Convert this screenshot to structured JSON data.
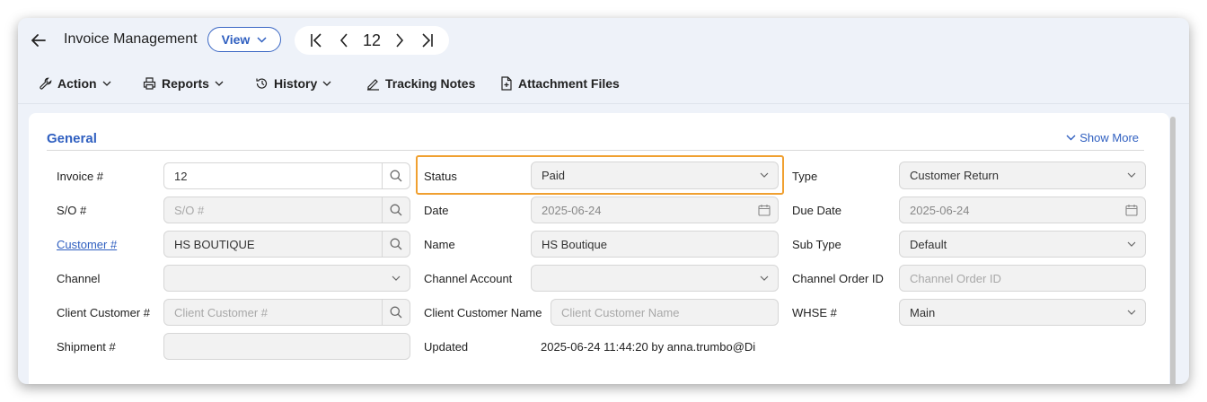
{
  "header": {
    "title": "Invoice Management",
    "view_label": "View",
    "record_number": "12"
  },
  "toolbar": {
    "action": "Action",
    "reports": "Reports",
    "history": "History",
    "tracking_notes": "Tracking Notes",
    "attachment_files": "Attachment Files"
  },
  "general": {
    "title": "General",
    "show_more": "Show More"
  },
  "fields": {
    "invoice": {
      "label": "Invoice #",
      "value": "12"
    },
    "so": {
      "label": "S/O #",
      "placeholder": "S/O #"
    },
    "customer": {
      "label": "Customer #",
      "value": "HS BOUTIQUE"
    },
    "channel": {
      "label": "Channel",
      "value": ""
    },
    "client_customer": {
      "label": "Client Customer #",
      "placeholder": "Client Customer #"
    },
    "shipment": {
      "label": "Shipment #",
      "value": ""
    },
    "status": {
      "label": "Status",
      "value": "Paid"
    },
    "date": {
      "label": "Date",
      "value": "2025-06-24"
    },
    "name": {
      "label": "Name",
      "value": "HS Boutique"
    },
    "channel_account": {
      "label": "Channel Account",
      "value": ""
    },
    "client_customer_name": {
      "label": "Client Customer Name",
      "placeholder": "Client Customer Name"
    },
    "updated": {
      "label": "Updated",
      "value": "2025-06-24 11:44:20 by anna.trumbo@Di"
    },
    "type": {
      "label": "Type",
      "value": "Customer Return"
    },
    "due_date": {
      "label": "Due Date",
      "value": "2025-06-24"
    },
    "sub_type": {
      "label": "Sub Type",
      "value": "Default"
    },
    "channel_order_id": {
      "label": "Channel Order ID",
      "placeholder": "Channel Order ID"
    },
    "whse": {
      "label": "WHSE #",
      "value": "Main"
    }
  },
  "colors": {
    "accent": "#2f5fc0",
    "highlight": "#f0a030"
  },
  "icons": {
    "back": "arrow-left-icon",
    "first": "first-page-icon",
    "prev": "chevron-left-icon",
    "next": "chevron-right-icon",
    "last": "last-page-icon",
    "search": "search-icon",
    "calendar": "calendar-icon",
    "dropdown": "chevron-down-icon"
  }
}
